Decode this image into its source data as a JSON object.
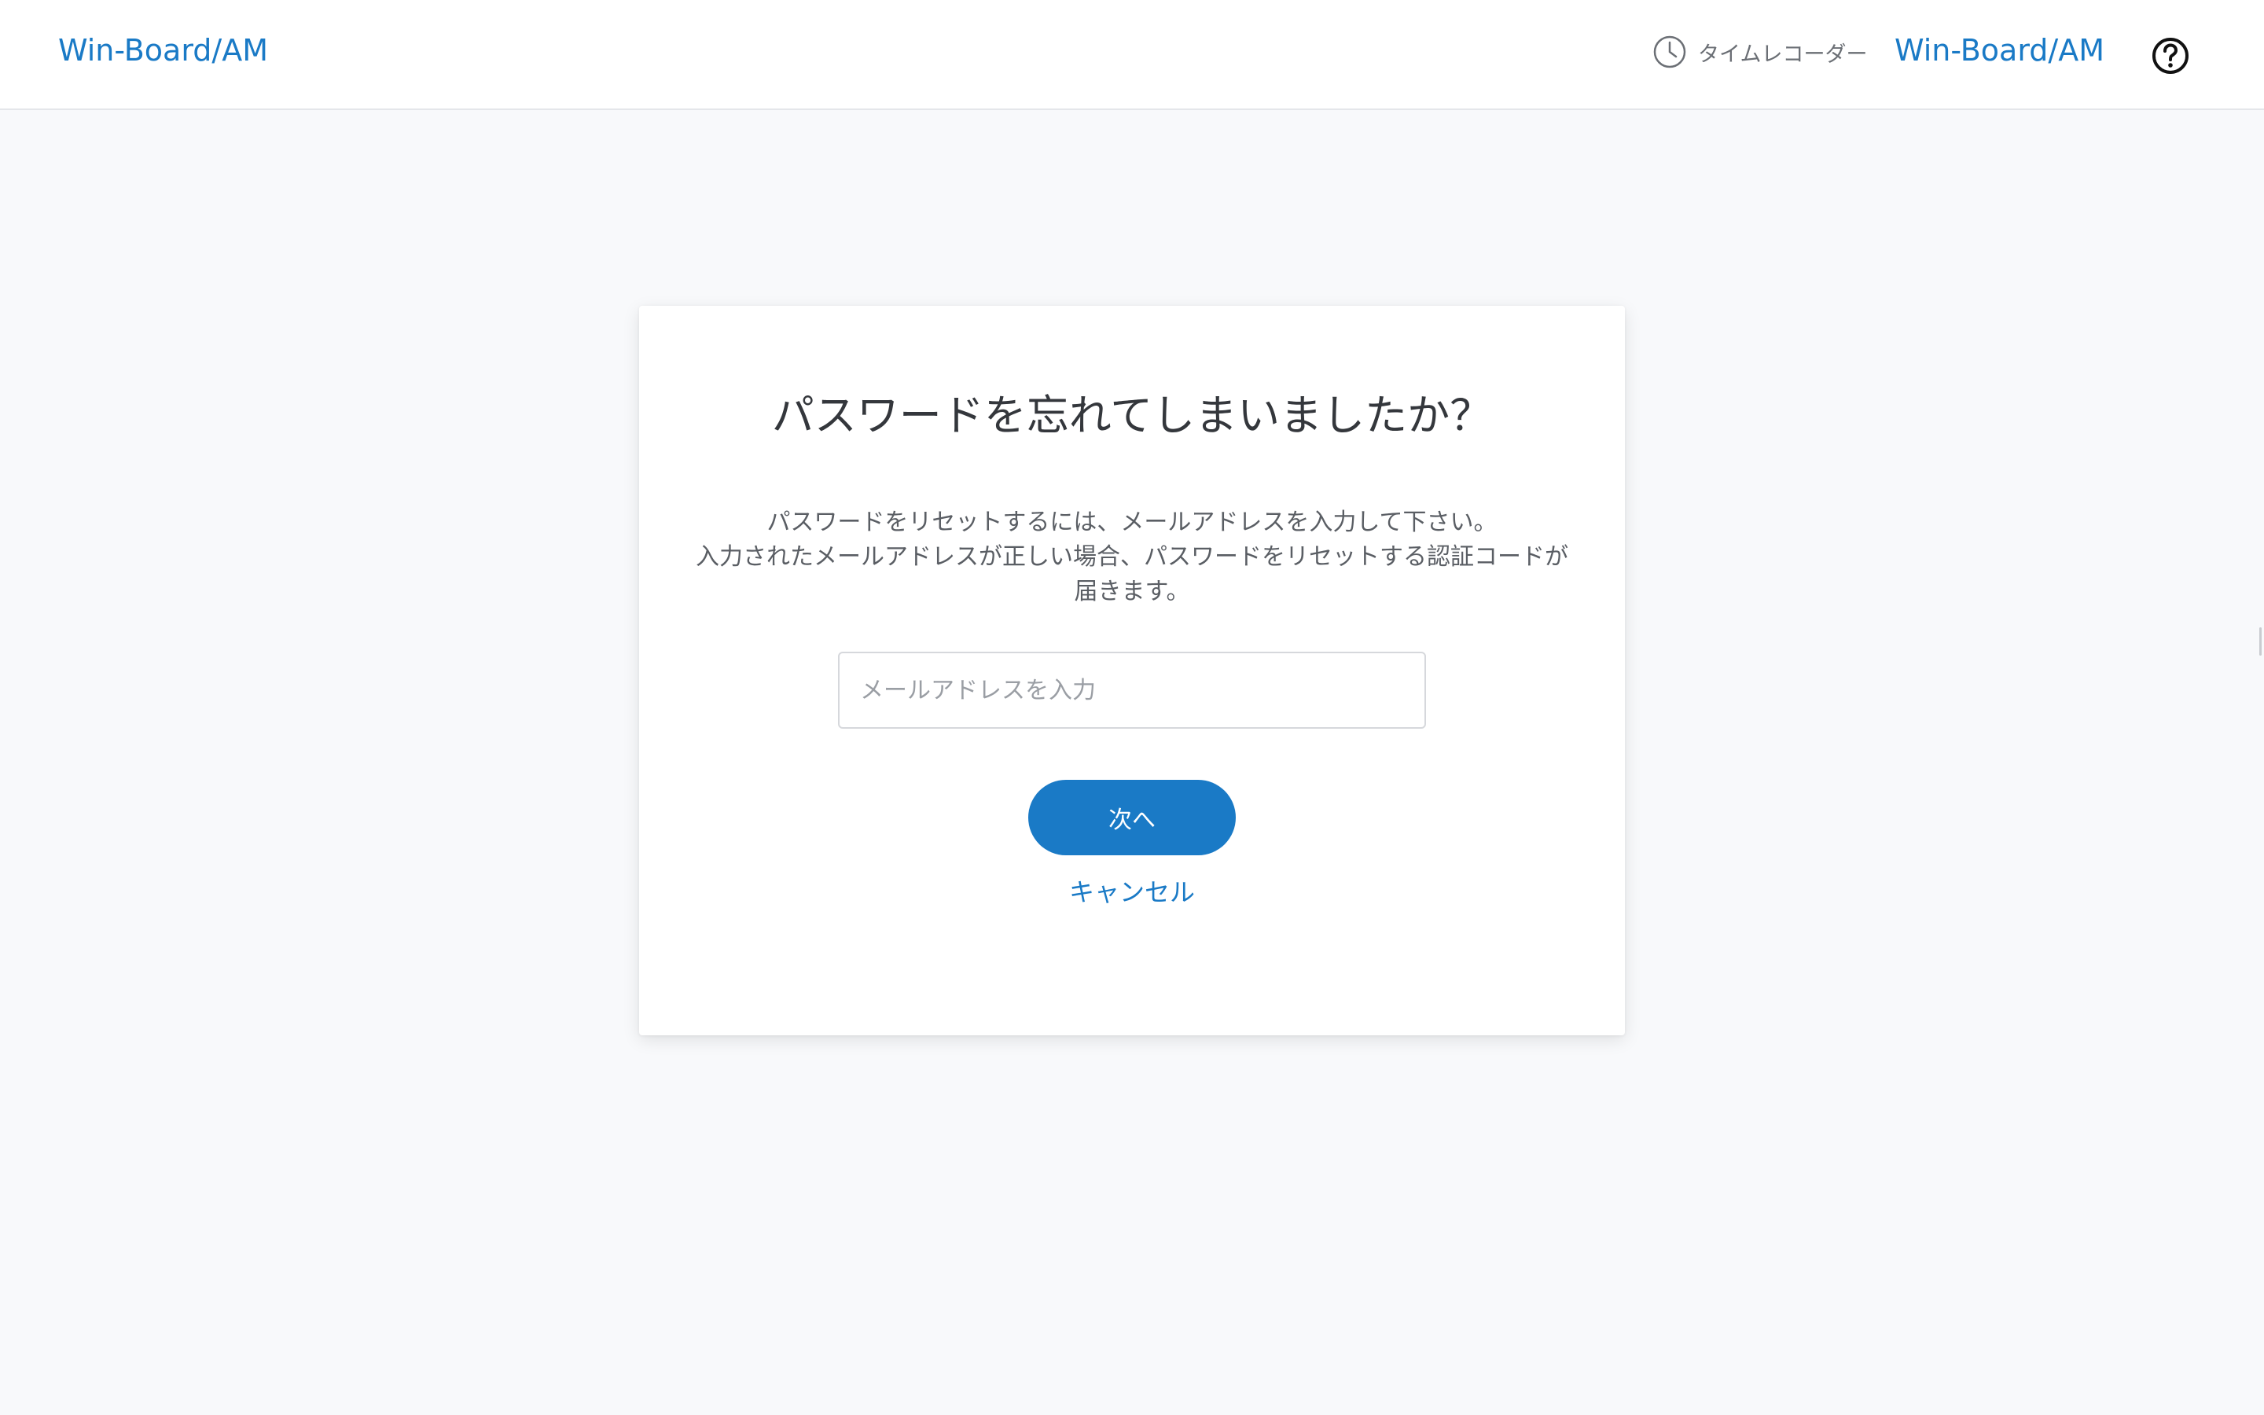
{
  "header": {
    "logo_left": "Win-Board/AM",
    "time_recorder_label": "タイムレコーダー",
    "logo_right": "Win-Board/AM",
    "icons": {
      "time_recorder": "clock-icon",
      "help": "help-circle-icon"
    }
  },
  "card": {
    "title": "パスワードを忘れてしまいましたか？",
    "description": {
      "line1": "パスワードをリセットするには、メールアドレスを入力して下さい。",
      "line2": "入力されたメールアドレスが正しい場合、パスワードをリセットする認証コードが",
      "line3": "届きます。"
    },
    "email": {
      "value": "",
      "placeholder": "メールアドレスを入力"
    },
    "next_button_label": "次へ",
    "cancel_label": "キャンセル"
  },
  "colors": {
    "accent": "#1a7ac6",
    "background": "#f8f9fb",
    "card": "#ffffff"
  }
}
